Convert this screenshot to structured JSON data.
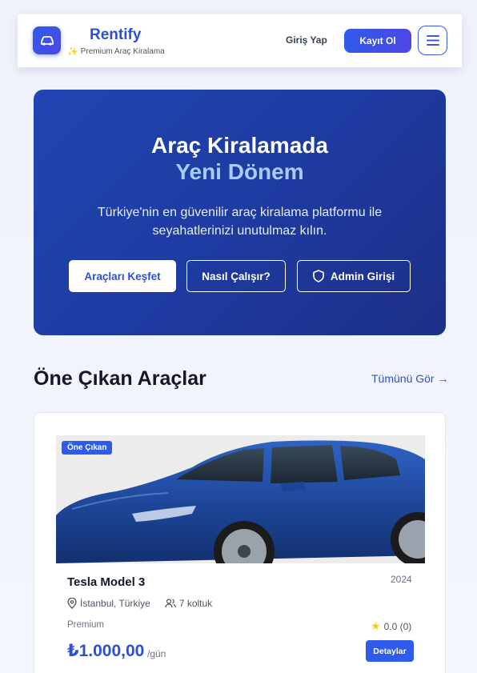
{
  "header": {
    "brand_name": "Rentify",
    "brand_tagline": "Premium Araç Kiralama",
    "login_label": "Giriş Yap",
    "signup_label": "Kayıt Ol",
    "logo_icon": "car-icon",
    "menu_icon": "hamburger-menu-icon",
    "accent_color": "#2f5bea"
  },
  "hero": {
    "title_line1": "Araç Kiralamada",
    "title_line2": "Yeni Dönem",
    "subtitle": "Türkiye'nin en güvenilir araç kiralama platformu ile seyahatlerinizi unutulmaz kılın.",
    "buttons": [
      {
        "label": "Araçları Keşfet"
      },
      {
        "label": "Nasıl Çalışır?"
      },
      {
        "label": "Admin Girişi",
        "icon": "shield-icon"
      }
    ]
  },
  "featured": {
    "title": "Öne Çıkan Araçlar",
    "see_all_label": "Tümünü Gör →",
    "cars": [
      {
        "badge": "Öne Çıkan",
        "name": "Tesla Model 3",
        "year": "2024",
        "location": "İstanbul, Türkiye",
        "seats": "7 koltuk",
        "class": "Premium",
        "rating": "0.0 (0)",
        "price": "₺1.000,00",
        "price_unit": "/gün",
        "details_label": "Detaylar",
        "car_color": "#1f4fa8"
      }
    ]
  }
}
